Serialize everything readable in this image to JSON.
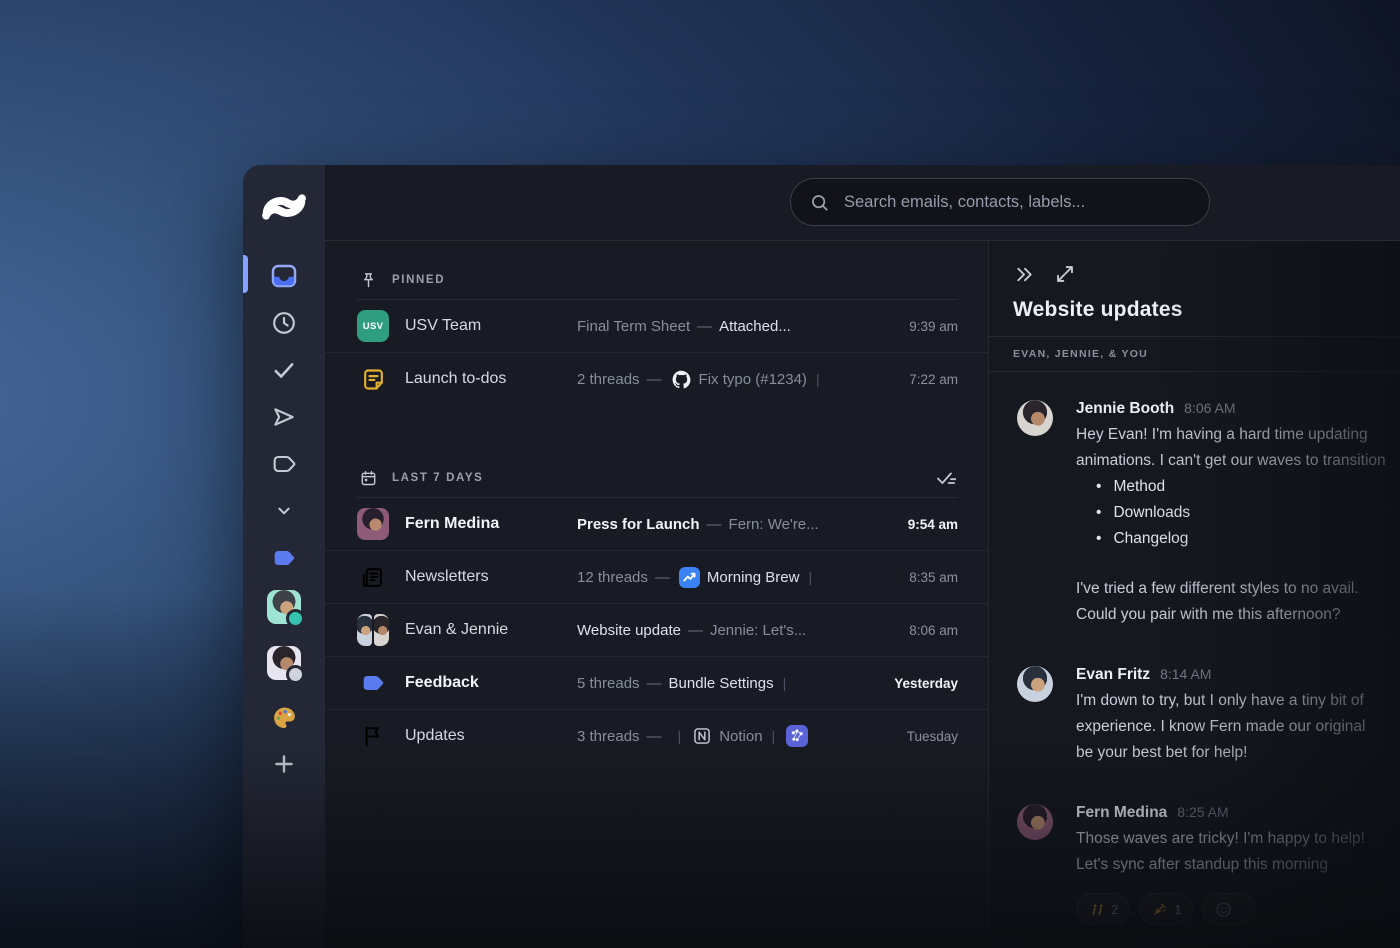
{
  "colors": {
    "accent_blue": "#6d8cf8",
    "tag_blue": "#5b7cf0",
    "active_pill": "#86a4ff",
    "usv_green": "#2f9d80",
    "note_yellow": "#e3b02e",
    "sidebar_bg": "#242836",
    "list_bg": "#181b23",
    "panel_bg": "#15181f",
    "gold": "#d9a441"
  },
  "search": {
    "placeholder": "Search emails, contacts, labels..."
  },
  "sidebar": {
    "items": [
      {
        "id": "inbox",
        "icon": "inbox-icon",
        "active": true
      },
      {
        "id": "snoozed",
        "icon": "clock-icon"
      },
      {
        "id": "done",
        "icon": "check-icon"
      },
      {
        "id": "sent",
        "icon": "send-icon"
      },
      {
        "id": "bundles",
        "icon": "label-outline-icon"
      },
      {
        "id": "more",
        "icon": "chevron-down-icon"
      },
      {
        "id": "label-blue",
        "icon": "tag-blue-icon"
      },
      {
        "id": "contact-evan",
        "icon": "avatar",
        "person": "evan_side",
        "status": "#35c3ad"
      },
      {
        "id": "contact-jennie",
        "icon": "avatar",
        "person": "jennie_side",
        "status": "#cfd4dc"
      },
      {
        "id": "theme-palette",
        "icon": "palette-icon"
      },
      {
        "id": "add",
        "icon": "plus-icon"
      }
    ]
  },
  "list": {
    "sections": [
      {
        "label": "PINNED",
        "icon": "pin-icon",
        "rows": [
          {
            "name": "USV Team",
            "avatar": {
              "type": "badge",
              "text": "USV",
              "bg": "#2f9d80"
            },
            "snippet": [
              {
                "text": "Final Term Sheet",
                "style": "dim"
              },
              {
                "text": "—",
                "style": "dash"
              },
              {
                "text": "Attached...",
                "style": "bright"
              }
            ],
            "time": "9:39 am"
          },
          {
            "name": "Launch to-dos",
            "avatar": {
              "type": "icon",
              "icon": "note-icon"
            },
            "snippet": [
              {
                "text": "2 threads",
                "style": "dim"
              },
              {
                "text": "—",
                "style": "dash"
              },
              {
                "icon": "github-icon"
              },
              {
                "text": "Fix typo (#1234)",
                "style": "dim"
              },
              {
                "text": "|",
                "style": "sep"
              }
            ],
            "time": "7:22 am"
          }
        ]
      },
      {
        "label": "LAST 7 DAYS",
        "icon": "calendar-icon",
        "action_icon": "mark-all-done-icon",
        "rows": [
          {
            "name": "Fern Medina",
            "unread": true,
            "avatar": {
              "type": "photo",
              "person": "fern"
            },
            "snippet": [
              {
                "text": "Press for Launch",
                "style": "subject"
              },
              {
                "text": "—",
                "style": "dash"
              },
              {
                "text": "Fern:  We're...",
                "style": "dim"
              }
            ],
            "time": "9:54 am",
            "time_bold": true
          },
          {
            "name": "Newsletters",
            "avatar": {
              "type": "icon",
              "icon": "newspaper-icon"
            },
            "snippet": [
              {
                "text": "12 threads",
                "style": "dim"
              },
              {
                "text": "—",
                "style": "dash"
              },
              {
                "icon": "morning-brew-icon"
              },
              {
                "text": "Morning Brew",
                "style": "bright"
              },
              {
                "text": "|",
                "style": "sep"
              }
            ],
            "time": "8:35 am"
          },
          {
            "name": "Evan & Jennie",
            "avatar": {
              "type": "duo",
              "persons": [
                "evan",
                "jennie"
              ]
            },
            "snippet": [
              {
                "text": "Website update",
                "style": "bright"
              },
              {
                "text": "—",
                "style": "dash"
              },
              {
                "text": "Jennie:  Let's...",
                "style": "dim"
              }
            ],
            "time": "8:06 am"
          },
          {
            "name": "Feedback",
            "unread": true,
            "avatar": {
              "type": "icon",
              "icon": "tag-blue-icon"
            },
            "snippet": [
              {
                "text": "5 threads",
                "style": "dim"
              },
              {
                "text": "—",
                "style": "dash"
              },
              {
                "text": "Bundle Settings",
                "style": "bright"
              },
              {
                "text": "|",
                "style": "sep"
              }
            ],
            "time": "Yesterday",
            "time_bold": true
          },
          {
            "name": "Updates",
            "avatar": {
              "type": "icon",
              "icon": "flag-icon"
            },
            "snippet": [
              {
                "text": "3 threads",
                "style": "dim"
              },
              {
                "text": "—",
                "style": "dash"
              },
              {
                "text": "|",
                "style": "sep"
              },
              {
                "icon": "notion-icon"
              },
              {
                "text": "Notion",
                "style": "dim"
              },
              {
                "text": "|",
                "style": "sep"
              },
              {
                "icon": "integration-icon"
              }
            ],
            "time": "Tuesday"
          }
        ]
      }
    ]
  },
  "panel": {
    "title": "Website updates",
    "participants": "EVAN, JENNIE, & YOU",
    "messages": [
      {
        "name": "Jennie Booth",
        "time": "8:06 AM",
        "person": "jennie",
        "lines": [
          "Hey Evan! I'm having a hard time updating",
          "animations. I can't get our waves to transition"
        ],
        "bullets": [
          "Method",
          "Downloads",
          "Changelog"
        ],
        "lines2": [
          "I've tried a few different styles to no avail.",
          "Could you pair with me this afternoon?"
        ]
      },
      {
        "name": "Evan Fritz",
        "time": "8:14 AM",
        "person": "evan",
        "lines": [
          "I'm down to try, but I only have a tiny bit of",
          "experience. I know Fern made our original",
          "be your best bet for help!"
        ]
      },
      {
        "name": "Fern Medina",
        "time": "8:25 AM",
        "person": "fern",
        "lines": [
          "Those waves are tricky! I'm happy to help!",
          "Let's sync after standup this morning"
        ],
        "reactions": [
          {
            "icon": "raised-hands-icon",
            "count": "2"
          },
          {
            "icon": "party-popper-icon",
            "count": "1"
          },
          {
            "icon": "add-reaction-icon",
            "count": ""
          }
        ]
      }
    ]
  }
}
